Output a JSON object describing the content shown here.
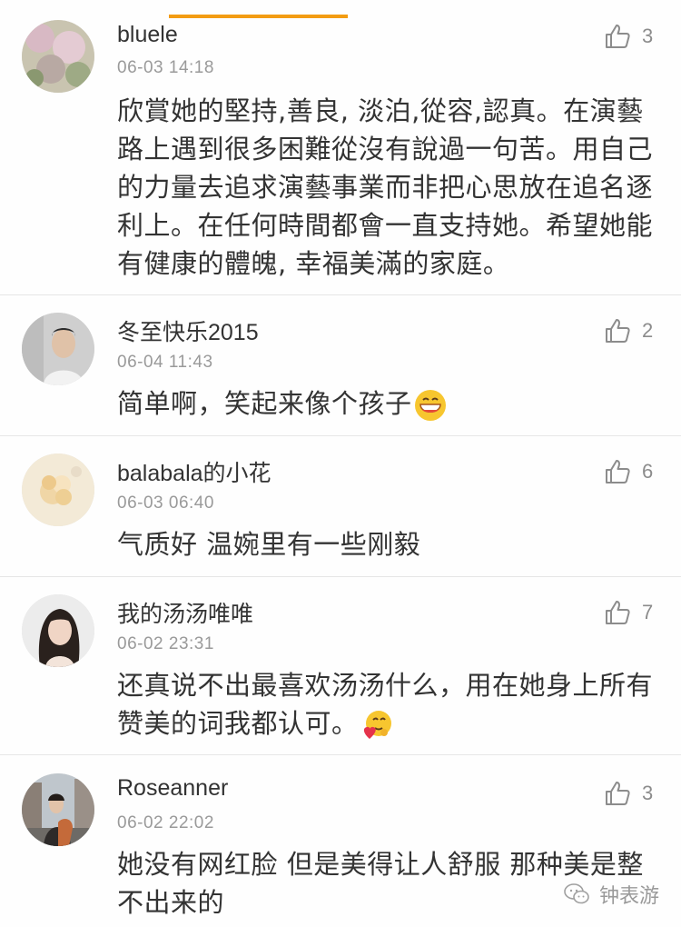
{
  "comments": [
    {
      "username": "bluele",
      "time": "06-03 14:18",
      "likes": "3",
      "text": "欣賞她的堅持,善良, 淡泊,從容,認真。在演藝路上遇到很多困難從沒有說過一句苦。用自己的力量去追求演藝事業而非把心思放在追名逐利上。在任何時間都會一直支持她。希望她能有健康的體魄, 幸福美滿的家庭。",
      "avatar": "flower-avatar"
    },
    {
      "username": "冬至快乐2015",
      "time": "06-04 11:43",
      "likes": "2",
      "text": "简单啊，笑起来像个孩子",
      "emoji": "grinning-face-emoji",
      "avatar": "man-portrait-avatar"
    },
    {
      "username": "balabala的小花",
      "time": "06-03 06:40",
      "likes": "6",
      "text": "气质好 温婉里有一些刚毅",
      "avatar": "blossom-avatar"
    },
    {
      "username": "我的汤汤唯唯",
      "time": "06-02 23:31",
      "likes": "7",
      "text": "还真说不出最喜欢汤汤什么，用在她身上所有赞美的词我都认可。",
      "emoji": "heart-hug-emoji",
      "avatar": "woman-portrait-avatar"
    },
    {
      "username": "Roseanner",
      "time": "06-02 22:02",
      "likes": "3",
      "text": "她没有网红脸 但是美得让人舒服 那种美是整不出来的",
      "avatar": "street-couple-avatar"
    }
  ],
  "watermark": {
    "text": "钟表游",
    "icon": "wechat-icon"
  },
  "colors": {
    "accent": "#f39c12",
    "divider": "#e6e6e6",
    "meta": "#9a9a9a"
  }
}
